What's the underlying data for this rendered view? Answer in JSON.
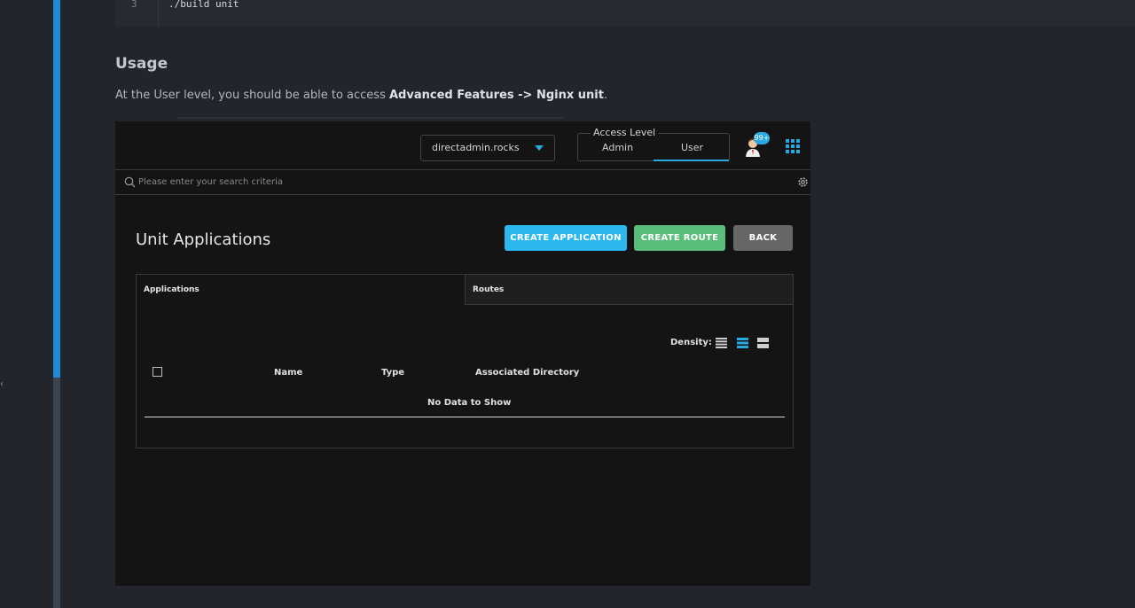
{
  "code": {
    "line_number": "3",
    "line_text": "./build unit"
  },
  "doc": {
    "heading": "Usage",
    "para_prefix": "At the User level, you should be able to access ",
    "para_bold": "Advanced Features -> Nginx unit",
    "para_suffix": "."
  },
  "rail": {
    "mark": "‹"
  },
  "app": {
    "domain_select": "directadmin.rocks",
    "access_level": {
      "legend": "Access Level",
      "options": [
        "Admin",
        "User"
      ],
      "selected": "User"
    },
    "notifications_badge": "99+",
    "search": {
      "placeholder": "Please enter your search criteria",
      "value": ""
    },
    "page_title": "Unit Applications",
    "buttons": {
      "create_application": "CREATE APPLICATION",
      "create_route": "CREATE ROUTE",
      "back": "BACK"
    },
    "tabs": [
      "Applications",
      "Routes"
    ],
    "active_tab": "Applications",
    "density": {
      "label": "Density:",
      "options": [
        "compact",
        "standard",
        "comfortable"
      ],
      "selected": "standard"
    },
    "table": {
      "columns": [
        "Name",
        "Type",
        "Associated Directory"
      ],
      "empty_text": "No Data to Show"
    }
  },
  "colors": {
    "accent": "#2ab8ef",
    "success": "#5bbd7a",
    "neutral": "#666666",
    "scrollbar": "#1f8ccf"
  },
  "icons": [
    "avatar-icon",
    "apps-grid-icon",
    "search-icon",
    "settings-icon",
    "caret-down-icon",
    "density-compact-icon",
    "density-standard-icon",
    "density-comfortable-icon"
  ]
}
